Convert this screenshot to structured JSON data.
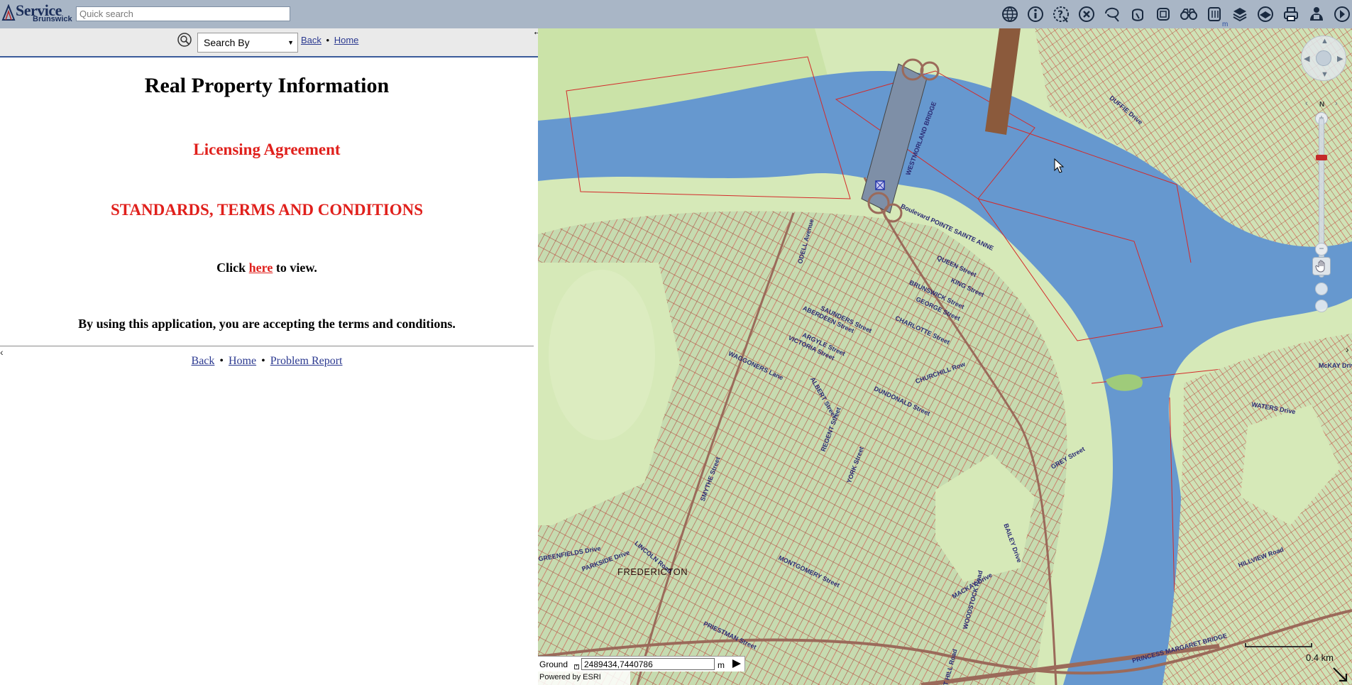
{
  "header": {
    "logo_word1": "Service",
    "logo_word2": "Brunswick",
    "quick_search_placeholder": "Quick search",
    "unit_label": "m",
    "tools": [
      {
        "name": "globe-icon"
      },
      {
        "name": "info-icon"
      },
      {
        "name": "query-icon"
      },
      {
        "name": "clear-icon"
      },
      {
        "name": "lasso-select-icon"
      },
      {
        "name": "identify-icon"
      },
      {
        "name": "frame-select-icon"
      },
      {
        "name": "binoculars-icon"
      },
      {
        "name": "measure-icon"
      },
      {
        "name": "layers-icon"
      },
      {
        "name": "basemap-icon"
      },
      {
        "name": "print-icon"
      },
      {
        "name": "user-help-icon"
      },
      {
        "name": "forward-icon"
      }
    ]
  },
  "left_panel": {
    "search_by_label": "Search By",
    "back_label": "Back",
    "home_label": "Home",
    "link_sep": "•",
    "title": "Real Property Information",
    "license_heading": "Licensing Agreement",
    "terms_heading": "STANDARDS, TERMS AND CONDITIONS",
    "click_prefix": "Click ",
    "click_link": "here",
    "click_suffix": " to view.",
    "accept_text": "By using this application, you are accepting the terms and conditions.",
    "footer": {
      "back": "Back",
      "home": "Home",
      "problem_report": "Problem Report",
      "sep": "•"
    }
  },
  "map": {
    "city_label": "FREDERICTON",
    "north_label": "N",
    "scale_label": "0.4 km",
    "coordinate_system_label": "Ground",
    "coordinates_value": "2489434,7440786",
    "coordinates_unit": "m",
    "powered_by": "Powered by ESRI",
    "colors": {
      "water": "#6698cf",
      "land": "#d6e9b8",
      "parcel_line": "#d52a2a",
      "road": "#9b6a5a"
    },
    "street_labels": [
      {
        "text": "WESTMORLAND BRIDGE"
      },
      {
        "text": "Boulevard POINTE SAINTE ANNE"
      },
      {
        "text": "QUEEN Street"
      },
      {
        "text": "KING Street"
      },
      {
        "text": "BRUNSWICK Street"
      },
      {
        "text": "CHARLOTTE Street"
      },
      {
        "text": "GEORGE Street"
      },
      {
        "text": "SAUNDERS Street"
      },
      {
        "text": "ABERDEEN Street"
      },
      {
        "text": "ARGYLE Street"
      },
      {
        "text": "VICTORIA Street"
      },
      {
        "text": "WAGGONERS Lane"
      },
      {
        "text": "SMYTHE Street"
      },
      {
        "text": "REGENT Street"
      },
      {
        "text": "YORK Street"
      },
      {
        "text": "CHURCHILL Row"
      },
      {
        "text": "WOODSTOCK Road"
      },
      {
        "text": "FOREST HILL Road"
      },
      {
        "text": "BAILEY Drive"
      },
      {
        "text": "MACKAY Drive"
      },
      {
        "text": "DUNDONALD Street"
      },
      {
        "text": "ALBERT Street"
      },
      {
        "text": "PRIESTMAN Street"
      },
      {
        "text": "PRINCESS MARGARET BRIDGE"
      },
      {
        "text": "LINCOLN Road"
      },
      {
        "text": "McKAY Drive"
      },
      {
        "text": "WATERS Drive"
      },
      {
        "text": "HILLVIEW Road"
      },
      {
        "text": "DUFFIE Drive"
      },
      {
        "text": "PARKSIDE Drive"
      },
      {
        "text": "GREENFIELDS Drive"
      },
      {
        "text": "GREY Street"
      },
      {
        "text": "ODELL Avenue"
      },
      {
        "text": "MONTGOMERY Street"
      }
    ]
  }
}
